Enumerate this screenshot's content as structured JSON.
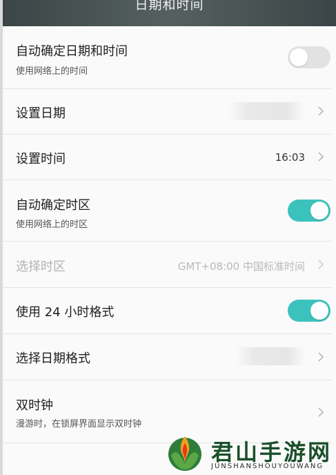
{
  "header": {
    "title": "日期和时间"
  },
  "rows": {
    "auto_datetime": {
      "title": "自动确定日期和时间",
      "subtitle": "使用网络上的时间",
      "toggle_on": false
    },
    "set_date": {
      "title": "设置日期",
      "value_redacted": true
    },
    "set_time": {
      "title": "设置时间",
      "value": "16:03"
    },
    "auto_timezone": {
      "title": "自动确定时区",
      "subtitle": "使用网络上的时区",
      "toggle_on": true
    },
    "select_timezone": {
      "title": "选择时区",
      "value": "GMT+08:00 中国标准时间",
      "disabled": true
    },
    "use_24h": {
      "title": "使用 24 小时格式",
      "toggle_on": true
    },
    "date_format": {
      "title": "选择日期格式",
      "value_redacted": true
    },
    "dual_clock": {
      "title": "双时钟",
      "subtitle": "漫游时，在锁屏界面显示双时钟"
    }
  },
  "watermark": {
    "text": "君山手游网",
    "subtext": "JUNSHANSHOUYOUWANG"
  },
  "colors": {
    "accent": "#3cc2bd",
    "header": "#4a5455",
    "toggle_off": "#e2e2e2"
  },
  "icons": {
    "chevron": "chevron-right-icon"
  }
}
